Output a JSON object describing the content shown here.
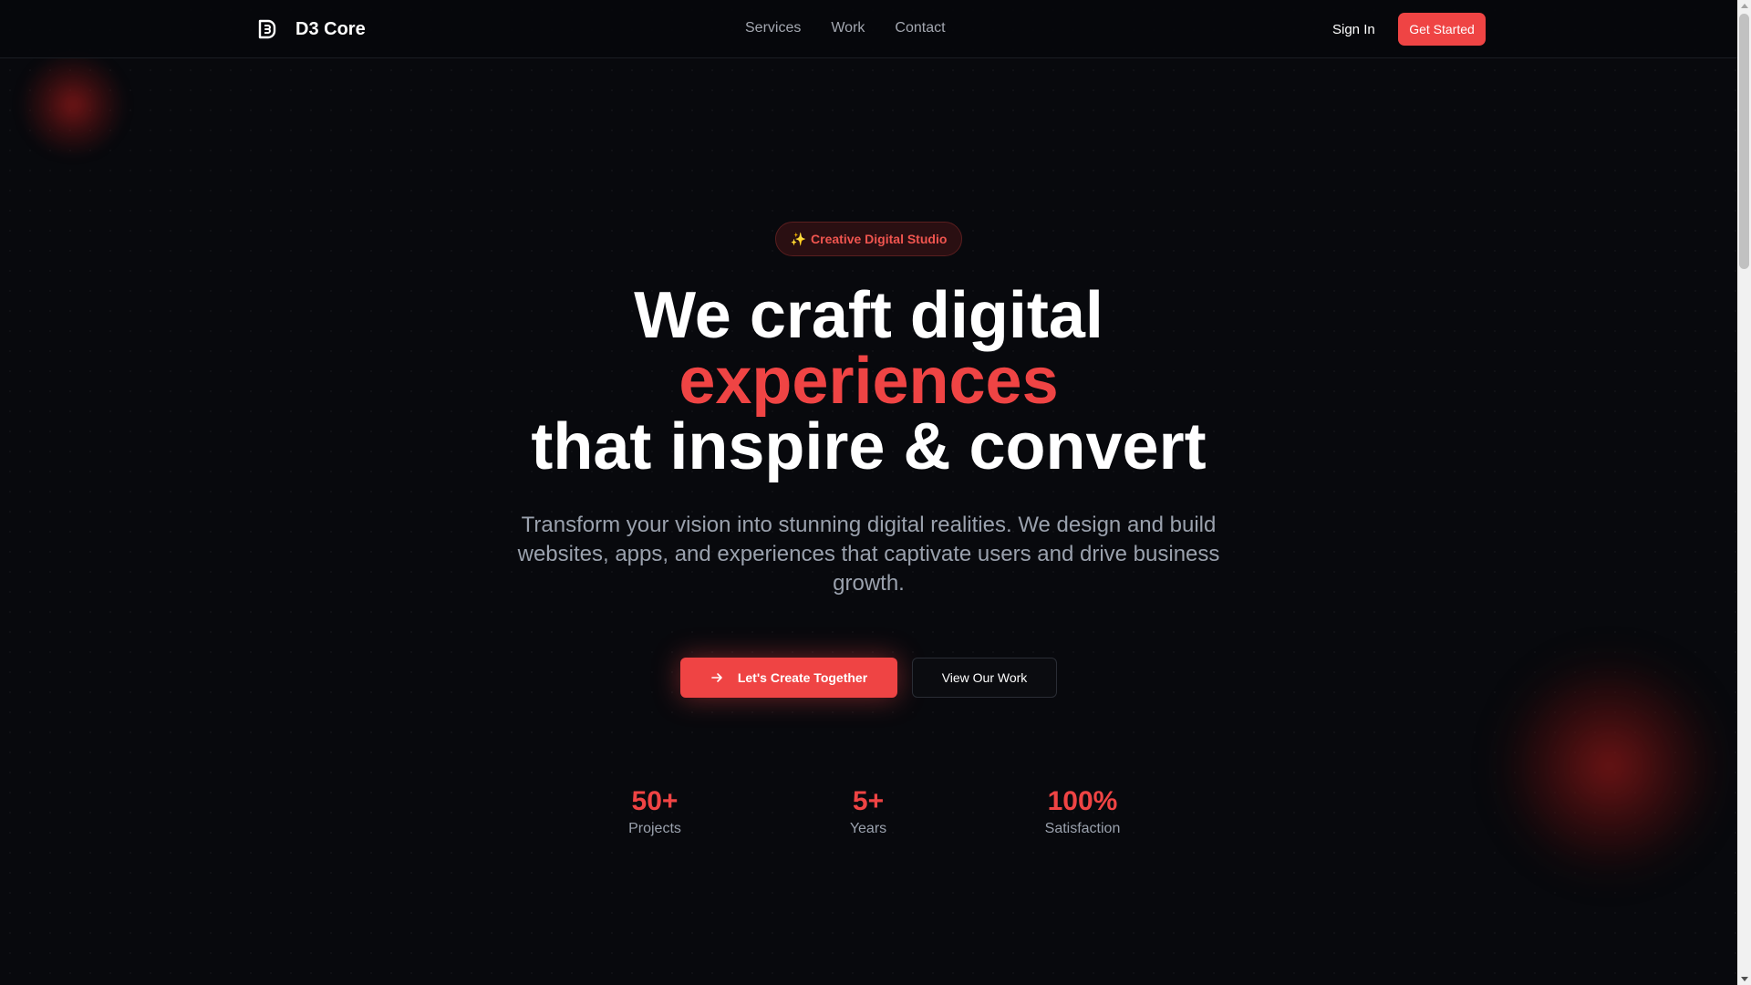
{
  "brand": {
    "name": "D3 Core",
    "logo_icon": "d3-logo-icon"
  },
  "nav": {
    "links": [
      "Services",
      "Work",
      "Contact"
    ],
    "sign_in": "Sign In",
    "get_started": "Get Started"
  },
  "hero": {
    "badge_icon": "✨",
    "badge": "Creative Digital Studio",
    "headline_line1": "We craft digital",
    "headline_accent": "experiences",
    "headline_line3": "that inspire & convert",
    "subtitle": "Transform your vision into stunning digital realities. We design and build websites, apps, and experiences that captivate users and drive business growth.",
    "primary_cta": "Let's Create Together",
    "primary_cta_icon": "arrow-right-icon",
    "secondary_cta": "View Our Work"
  },
  "stats": [
    {
      "value": "50+",
      "label": "Projects"
    },
    {
      "value": "5+",
      "label": "Years"
    },
    {
      "value": "100%",
      "label": "Satisfaction"
    }
  ],
  "colors": {
    "accent": "#ef4444",
    "background": "#08090d",
    "muted_text": "#9aa1ad"
  }
}
